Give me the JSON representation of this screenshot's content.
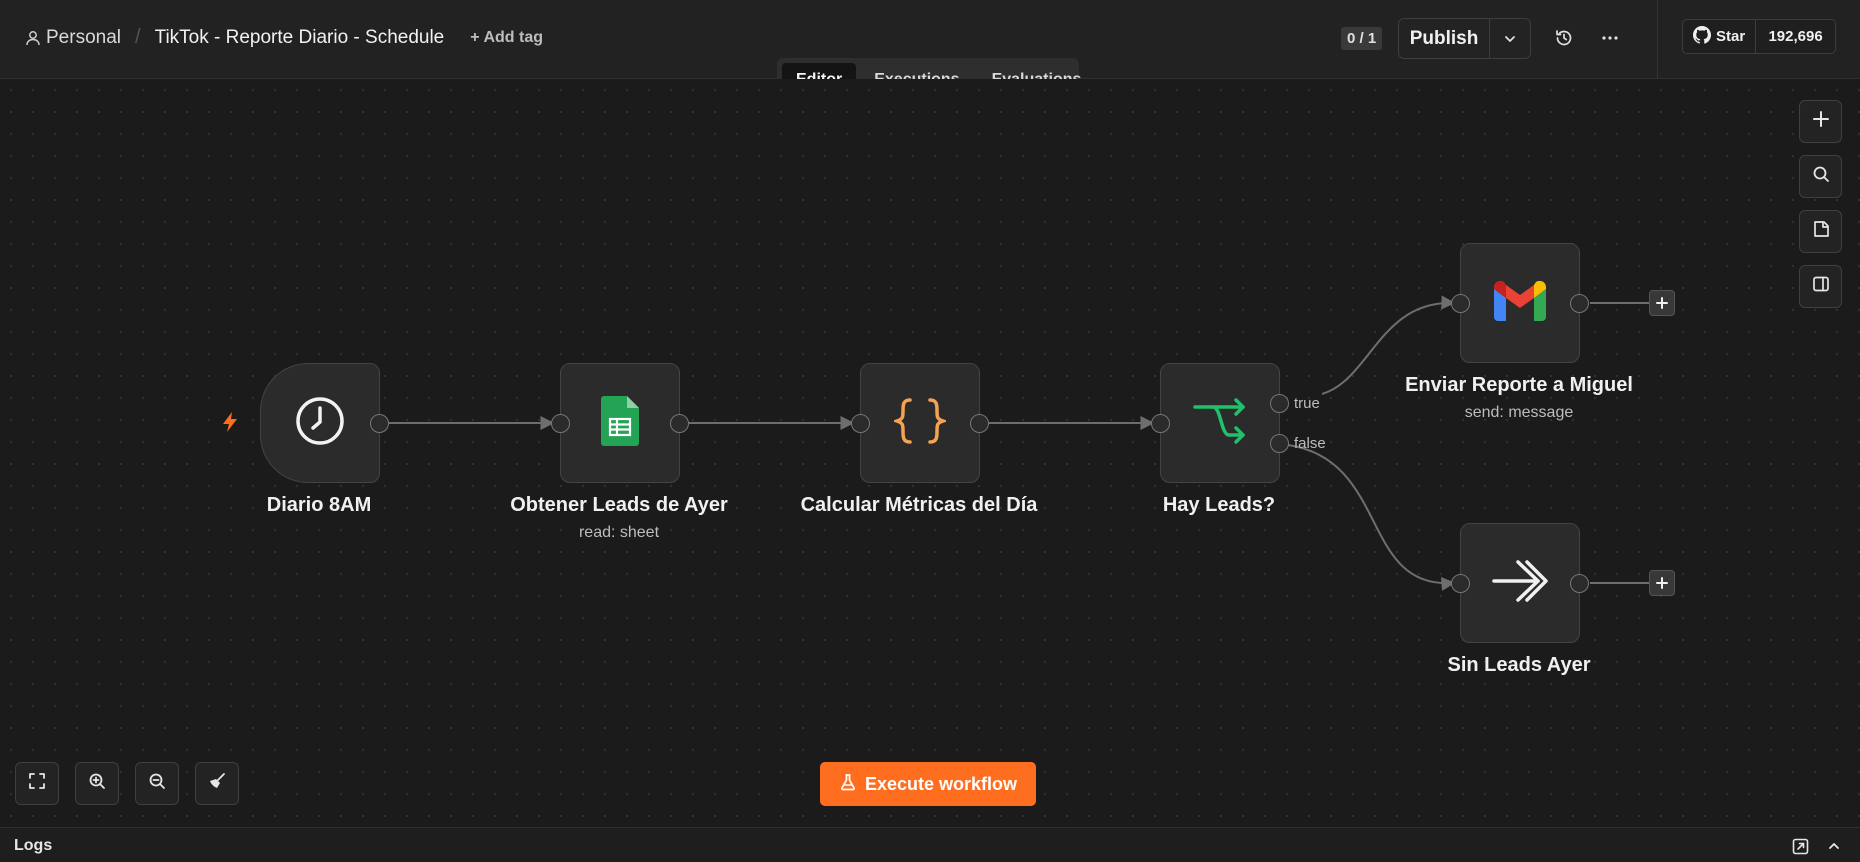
{
  "breadcrumb": {
    "project": "Personal",
    "separator": "/",
    "workflow_title": "TikTok - Reporte Diario - Schedule",
    "add_tag": "+ Add tag"
  },
  "header": {
    "counter": "0 / 1",
    "publish_label": "Publish",
    "github_star_label": "Star",
    "github_star_count": "192,696"
  },
  "tabs": [
    {
      "label": "Editor",
      "active": true
    },
    {
      "label": "Executions",
      "active": false
    },
    {
      "label": "Evaluations",
      "active": false
    }
  ],
  "nodes": {
    "trigger": {
      "label": "Diario 8AM",
      "icon": "clock-icon"
    },
    "sheets": {
      "label": "Obtener Leads de Ayer",
      "subtitle": "read: sheet",
      "icon": "google-sheets-icon"
    },
    "code": {
      "label": "Calcular Métricas del Día",
      "icon": "code-braces-icon"
    },
    "if": {
      "label": "Hay Leads?",
      "icon": "branch-icon",
      "true_label": "true",
      "false_label": "false"
    },
    "gmail": {
      "label": "Enviar Reporte a Miguel",
      "subtitle": "send: message",
      "icon": "gmail-icon"
    },
    "noop": {
      "label": "Sin Leads Ayer",
      "icon": "no-op-arrow-icon"
    }
  },
  "execute_button": "Execute workflow",
  "logs": {
    "label": "Logs"
  },
  "colors": {
    "accent": "#ff6d1f",
    "canvas": "#1b1b1b",
    "node": "#2b2b2b",
    "sheets_green": "#23a455",
    "code_orange": "#f5a350",
    "if_green": "#1fc16b"
  }
}
